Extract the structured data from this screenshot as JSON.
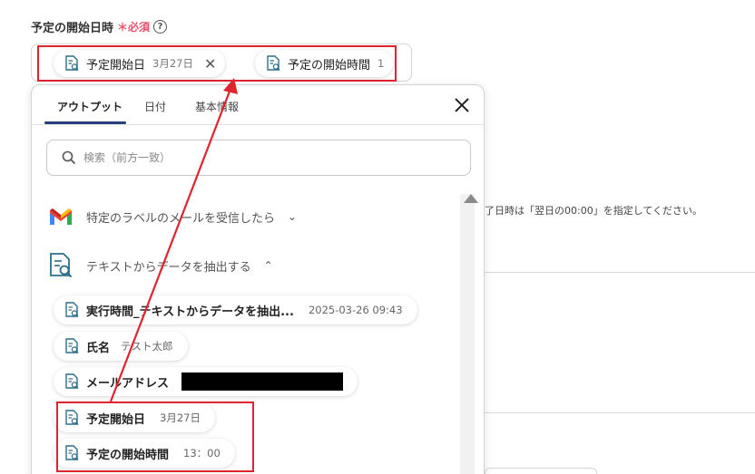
{
  "field": {
    "label": "予定の開始日時",
    "required_mark": "＊",
    "required_text": "必須",
    "help_glyph": "?"
  },
  "value_chips": [
    {
      "label": "予定開始日",
      "value": "3月27日",
      "close": "✕"
    },
    {
      "label": "予定の開始時間",
      "value": "1"
    }
  ],
  "panel": {
    "tabs": [
      "アウトプット",
      "日付",
      "基本情報"
    ],
    "active_tab": "アウトプット",
    "close": "✕",
    "search_placeholder": "検索（前方一致）",
    "sections": [
      {
        "title": "特定のラベルのメールを受信したら",
        "chevron": "⌄",
        "icon": "gmail-icon"
      },
      {
        "title": "テキストからデータを抽出する",
        "chevron": "⌃",
        "icon": "document-search-icon"
      }
    ],
    "items": [
      {
        "label": "実行時間_テキストからデータを抽出...",
        "value": "2025-03-26 09:43"
      },
      {
        "label": "氏名",
        "value": "テスト太郎"
      },
      {
        "label": "メールアドレス",
        "value": ""
      },
      {
        "label": "予定開始日",
        "value": "3月27日"
      },
      {
        "label": "予定の開始時間",
        "value": "13：00"
      }
    ]
  },
  "background": {
    "hint_text": "了日時は「翌日の00:00」を指定してください。"
  },
  "colors": {
    "accent": "#25407c",
    "required": "#e8546b",
    "highlight": "#e0242e",
    "icon": "#2c6e8a"
  }
}
